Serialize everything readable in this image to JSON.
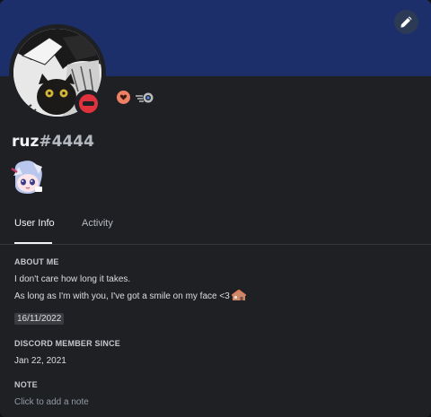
{
  "profile": {
    "username": "ruz",
    "discriminator": "#4444",
    "status": "do-not-disturb"
  },
  "icons": {
    "edit": "pencil-icon",
    "badge_1": "heart-badge-icon",
    "badge_2": "nitro-badge-icon"
  },
  "colors": {
    "banner": "#1c2f6b",
    "status_dnd": "#e0323d",
    "badge_heart": "#f08063"
  },
  "tabs": [
    {
      "label": "User Info",
      "selected": true
    },
    {
      "label": "Activity",
      "selected": false
    }
  ],
  "about": {
    "title": "ABOUT ME",
    "line1": "I don't care how long it takes.",
    "line2": "As long as I'm with you, I've got a smile on my face <3",
    "date": "16/11/2022"
  },
  "member_since": {
    "title": "DISCORD MEMBER SINCE",
    "value": "Jan 22, 2021"
  },
  "note": {
    "title": "NOTE",
    "placeholder": "Click to add a note"
  }
}
